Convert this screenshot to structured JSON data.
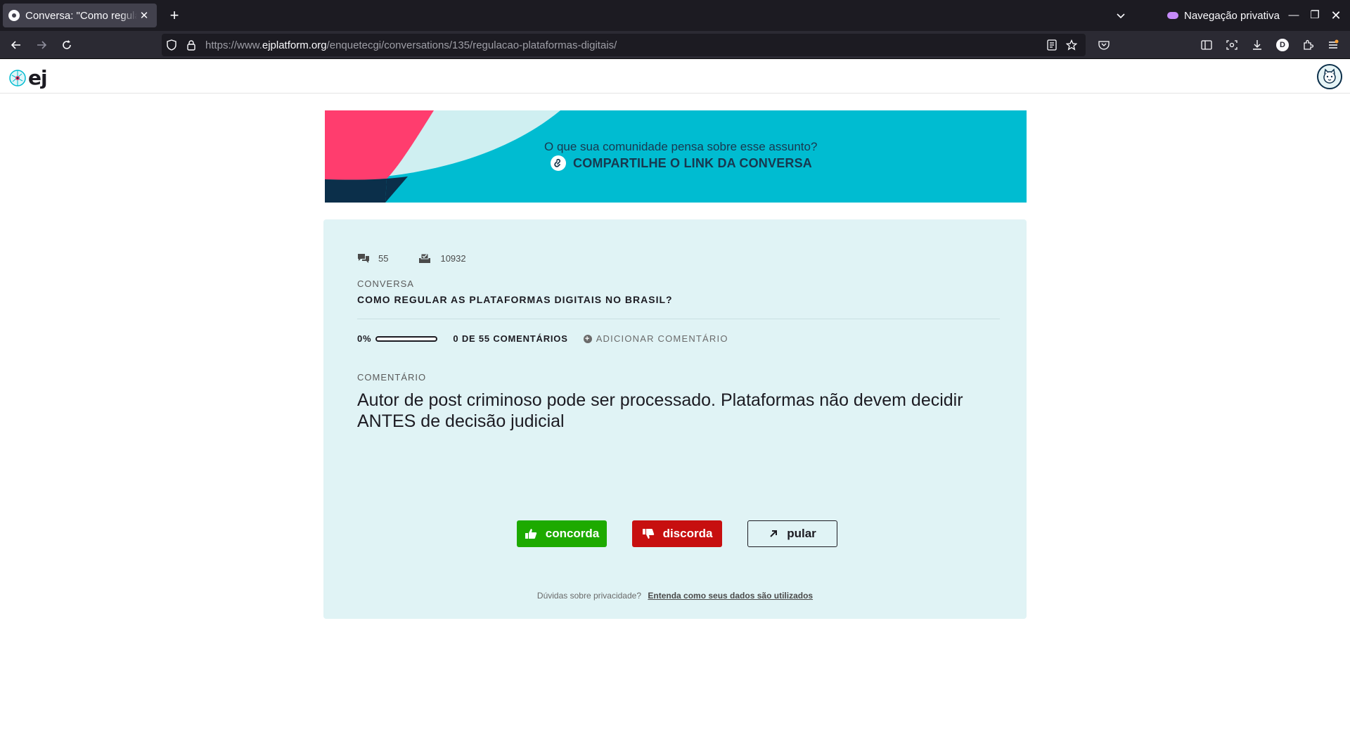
{
  "browser": {
    "tab_title": "Conversa: \"Como regular",
    "private_label": "Navegação privativa",
    "url_prefix": "https://www.",
    "url_domain": "ejplatform.org",
    "url_path": "/enquetecgi/conversations/135/regulacao-plataformas-digitais/",
    "profile_initial": "D"
  },
  "app": {
    "logo_text": "ej"
  },
  "banner": {
    "question": "O que sua comunidade pensa sobre esse assunto?",
    "share_label": "COMPARTILHE O LINK DA CONVERSA",
    "colors": {
      "background": "#00bcd1",
      "pink": "#ff3d6e",
      "navy": "#0b2f4a",
      "pale": "#cfeff1"
    }
  },
  "conversation": {
    "comments_count": "55",
    "votes_count": "10932",
    "section_label": "CONVERSA",
    "title": "COMO REGULAR AS PLATAFORMAS DIGITAIS NO BRASIL?",
    "progress_percent": "0%",
    "progress_value": 0,
    "progress_text": "0 DE 55 COMENTÁRIOS",
    "add_comment_label": "ADICIONAR COMENTÁRIO",
    "comment_label": "COMENTÁRIO",
    "comment_text": "Autor de post criminoso pode ser processado. Plataformas não devem decidir ANTES de decisão judicial"
  },
  "actions": {
    "agree_label": "concorda",
    "disagree_label": "discorda",
    "skip_label": "pular",
    "colors": {
      "agree": "#1daa00",
      "disagree": "#c70f0f"
    }
  },
  "privacy": {
    "question": "Dúvidas sobre privacidade?",
    "link_text": "Entenda como seus dados são utilizados"
  }
}
